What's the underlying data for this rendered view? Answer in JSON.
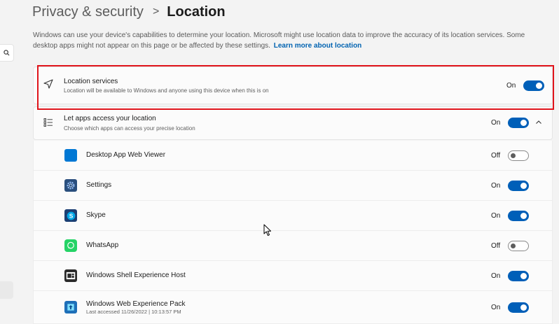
{
  "header": {
    "parent": "Privacy & security",
    "separator": ">",
    "current": "Location"
  },
  "description": {
    "text": "Windows can use your device's capabilities to determine your location. Microsoft might use location data to improve the accuracy of its location services. Some desktop apps might not appear on this page or be affected by these settings.",
    "link": "Learn more about location"
  },
  "location_services": {
    "title": "Location services",
    "subtitle": "Location will be available to Windows and anyone using this device when this is on",
    "state": "On"
  },
  "apps_access": {
    "title": "Let apps access your location",
    "subtitle": "Choose which apps can access your precise location",
    "state": "On"
  },
  "apps": [
    {
      "name": "Desktop App Web Viewer",
      "state": "Off",
      "icon": "blue-square-icon"
    },
    {
      "name": "Settings",
      "state": "On",
      "icon": "settings-gear-icon"
    },
    {
      "name": "Skype",
      "state": "On",
      "icon": "skype-icon"
    },
    {
      "name": "WhatsApp",
      "state": "Off",
      "icon": "whatsapp-icon"
    },
    {
      "name": "Windows Shell Experience Host",
      "state": "On",
      "icon": "shell-host-icon"
    },
    {
      "name": "Windows Web Experience Pack",
      "sub": "Last accessed 11/26/2022 | 10:13:57 PM",
      "state": "On",
      "icon": "web-experience-icon"
    }
  ],
  "colors": {
    "accent": "#005fb8",
    "highlight": "#e0141b"
  }
}
